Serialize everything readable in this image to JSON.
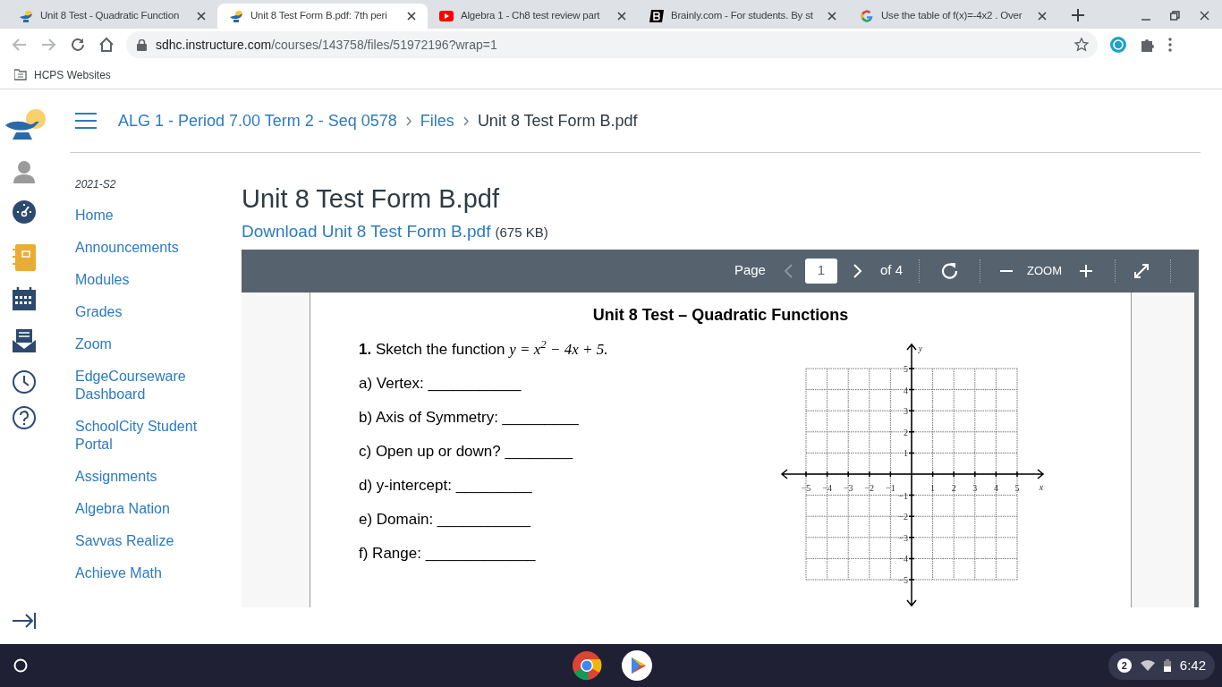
{
  "browser": {
    "tabs": [
      {
        "title": "Unit 8 Test - Quadratic Function",
        "kind": "canvas",
        "selected": false
      },
      {
        "title": "Unit 8 Test Form B.pdf: 7th peri",
        "kind": "canvas",
        "selected": true
      },
      {
        "title": "Algebra 1 - Ch8 test review part",
        "kind": "youtube",
        "selected": false
      },
      {
        "title": "Brainly.com - For students. By st",
        "kind": "brainly",
        "selected": false
      },
      {
        "title": "Use the table of f(x)=-4x2 . Over",
        "kind": "google",
        "selected": false
      }
    ],
    "address": {
      "host": "sdhc.instructure.com",
      "path": "/courses/143758/files/51972196?wrap=1"
    },
    "bookmarks": [
      {
        "label": "HCPS Websites"
      }
    ]
  },
  "breadcrumbs": [
    {
      "label": "ALG 1 - Period 7.00 Term 2 - Seq 0578",
      "link": true
    },
    {
      "label": "Files",
      "link": true
    },
    {
      "label": "Unit 8 Test Form B.pdf",
      "link": false
    }
  ],
  "course_nav": {
    "term": "2021-S2",
    "items": [
      {
        "label": "Home"
      },
      {
        "label": "Announcements"
      },
      {
        "label": "Modules"
      },
      {
        "label": "Grades"
      },
      {
        "label": "Zoom"
      },
      {
        "label": "EdgeCourseware Dashboard"
      },
      {
        "label": "SchoolCity Student Portal"
      },
      {
        "label": "Assignments"
      },
      {
        "label": "Algebra Nation"
      },
      {
        "label": "Savvas Realize"
      },
      {
        "label": "Achieve Math"
      }
    ]
  },
  "file": {
    "title": "Unit 8 Test Form B.pdf",
    "download_link": "Download Unit 8 Test Form B.pdf",
    "size": "(675 KB)"
  },
  "viewer": {
    "page_label": "Page",
    "page_value": "1",
    "page_count": "of 4",
    "zoom_label": "ZOOM"
  },
  "document": {
    "heading": "Unit 8 Test – Quadratic Functions",
    "question": "**1.** Sketch the function",
    "equation": "y = x$^{2}$ − 4x + 5.",
    "parts": [
      "a) Vertex: ___________",
      "b) Axis of Symmetry: _________",
      "c) Open up or down? ________",
      "d) y-intercept: _________",
      "e) Domain: ___________",
      "f) Range: _____________"
    ],
    "graph": {
      "x_label": "x",
      "y_label": "y",
      "x_ticks": [
        "−5",
        "−4",
        "−3",
        "−2",
        "−1",
        "1",
        "2",
        "3",
        "4",
        "5"
      ],
      "y_ticks": [
        "5",
        "4",
        "3",
        "2",
        "1",
        "−1",
        "−2",
        "−3",
        "−4",
        "−5"
      ]
    }
  },
  "taskbar": {
    "notification_count": "2",
    "time": "6:42"
  }
}
